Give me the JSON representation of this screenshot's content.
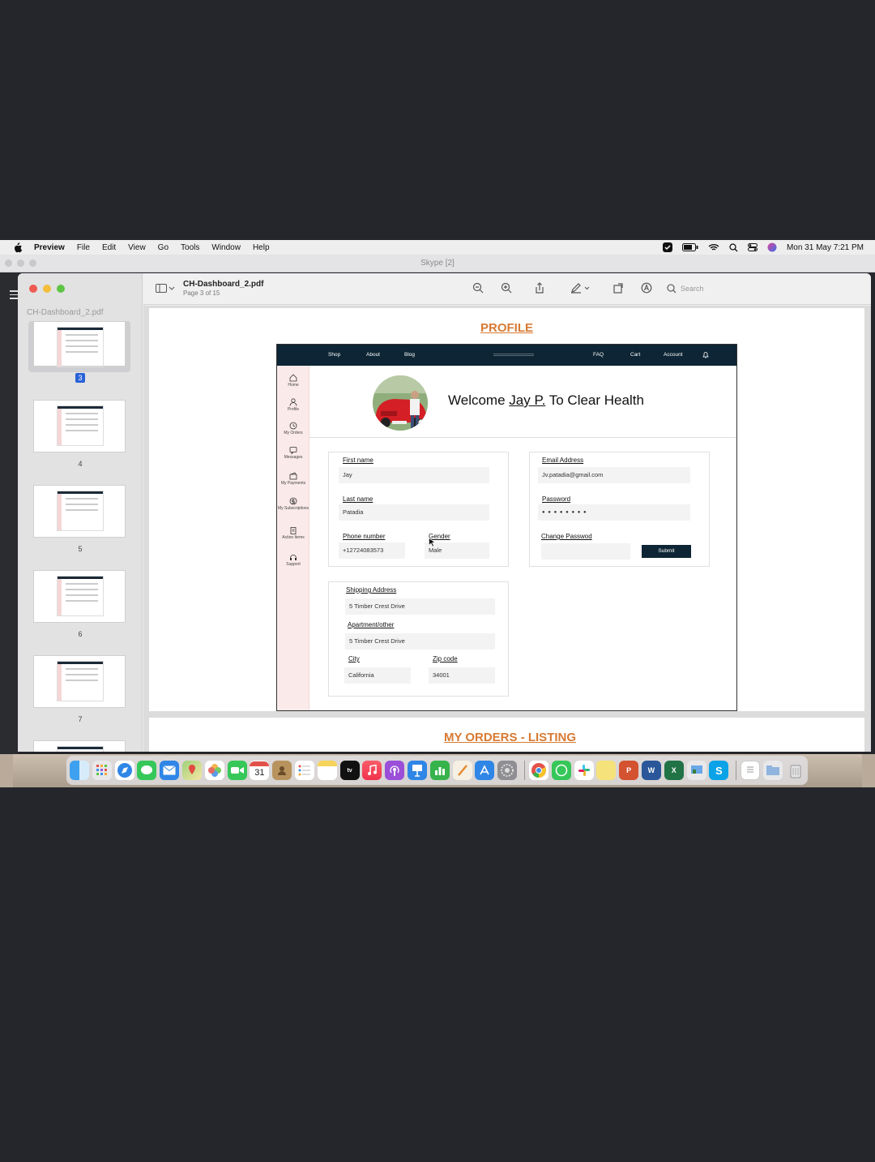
{
  "menubar": {
    "app": "Preview",
    "items": [
      "File",
      "Edit",
      "View",
      "Go",
      "Tools",
      "Window",
      "Help"
    ],
    "clock": "Mon 31 May  7:21 PM"
  },
  "skype": {
    "title": "Skype [2]"
  },
  "preview": {
    "sidebar_filename": "CH-Dashboard_2.pdf",
    "thumbnails": [
      "3",
      "4",
      "5",
      "6",
      "7"
    ],
    "doc_title": "CH-Dashboard_2.pdf",
    "doc_subtitle": "Page 3 of 15",
    "search_placeholder": "Search"
  },
  "page": {
    "title": "PROFILE",
    "next_title": "MY ORDERS - LISTING"
  },
  "mockup": {
    "nav": {
      "shop": "Shop",
      "about": "About",
      "blog": "Blog",
      "faq": "FAQ",
      "cart": "Cart",
      "account": "Account"
    },
    "sidebar": [
      "Home",
      "Profile",
      "My Orders",
      "Messages",
      "My Payments",
      "My Subscriptions",
      "Action Items",
      "Support"
    ],
    "welcome_pre": "Welcome ",
    "welcome_name": "Jay P.",
    "welcome_post": " To Clear Health",
    "form": {
      "first_name_label": "First name",
      "first_name": "Jay",
      "last_name_label": "Last name",
      "last_name": "Patadia",
      "phone_label": "Phone number",
      "phone": "+12724083573",
      "gender_label": "Gender",
      "gender": "Male",
      "email_label": "Email Address",
      "email": "Jv.patadia@gmail.com",
      "password_label": "Password",
      "password": "● ● ● ● ● ● ● ●",
      "change_password_label": "Change Passwod",
      "submit": "Submit",
      "shipping_label": "Shipping Address",
      "shipping": "5 Timber Crest Drive",
      "apartment_label": "Apartment/other",
      "apartment": "5 Timber Crest Drive",
      "city_label": "City",
      "city": "California",
      "zip_label": "Zip code",
      "zip": "34001"
    }
  },
  "dock": {
    "apps": [
      "finder-icon",
      "launchpad-icon",
      "safari-icon",
      "messages-icon",
      "mail-icon",
      "maps-icon",
      "photos-icon",
      "facetime-icon",
      "calendar-icon",
      "contacts-icon",
      "reminders-icon",
      "notes-icon",
      "appletv-icon",
      "music-icon",
      "podcasts-icon",
      "keynote-icon",
      "numbers-icon",
      "pages-icon",
      "appstore-icon",
      "settings-icon",
      "chrome-icon",
      "whatsapp-icon",
      "slack-icon",
      "stickies-icon",
      "powerpoint-icon",
      "word-icon",
      "excel-icon",
      "preview-icon",
      "skype-icon",
      "document-icon",
      "folder-icon",
      "trash-icon"
    ],
    "calendar_day": "31"
  }
}
